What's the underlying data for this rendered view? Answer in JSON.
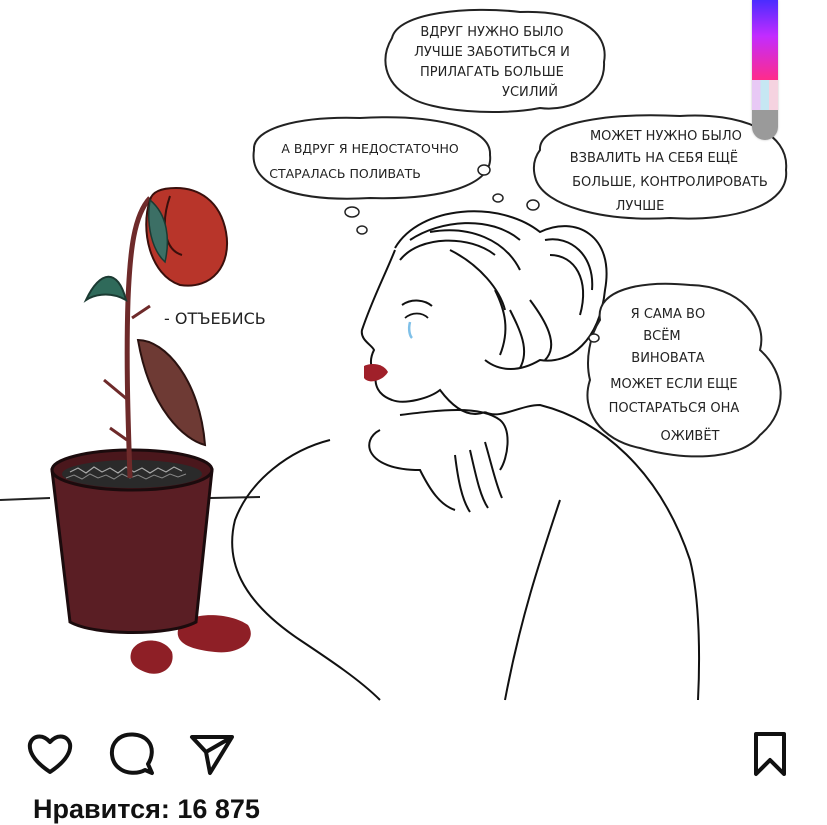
{
  "post": {
    "drawing": {
      "rose_caption": "- ОТЪЕБИСЬ",
      "thoughts": [
        {
          "lines": [
            "ВДРУГ НУЖНО БЫЛО",
            "ЛУЧШЕ ЗАБОТИТЬСЯ И",
            "ПРИЛАГАТЬ БОЛЬШЕ",
            "УСИЛИЙ"
          ]
        },
        {
          "lines": [
            "А ВДРУГ Я НЕДОСТАТОЧНО",
            "СТАРАЛАСЬ ПОЛИВАТЬ"
          ]
        },
        {
          "lines": [
            "МОЖЕТ НУЖНО БЫЛО",
            "ВЗВАЛИТЬ НА СЕБЯ ЕЩЁ",
            "БОЛЬШЕ, КОНТРОЛИРОВАТЬ",
            "ЛУЧШЕ"
          ]
        },
        {
          "lines": [
            "Я САМА ВО",
            "ВСЁМ",
            "ВИНОВАТА",
            "МОЖЕТ ЕСЛИ ЕЩЕ",
            "ПОСТАРАТЬСЯ ОНА",
            "ОЖИВЁТ"
          ]
        }
      ]
    },
    "likes_text": "Нравится: 16 875"
  },
  "icons": {
    "like": "heart-icon",
    "comment": "comment-bubble-icon",
    "share": "paper-plane-icon",
    "save": "bookmark-icon"
  },
  "colors": {
    "text": "#111111",
    "rose": "#b8352a",
    "pot": "#5a1e24",
    "lips": "#a0202a",
    "tear": "#7fc0e8"
  }
}
